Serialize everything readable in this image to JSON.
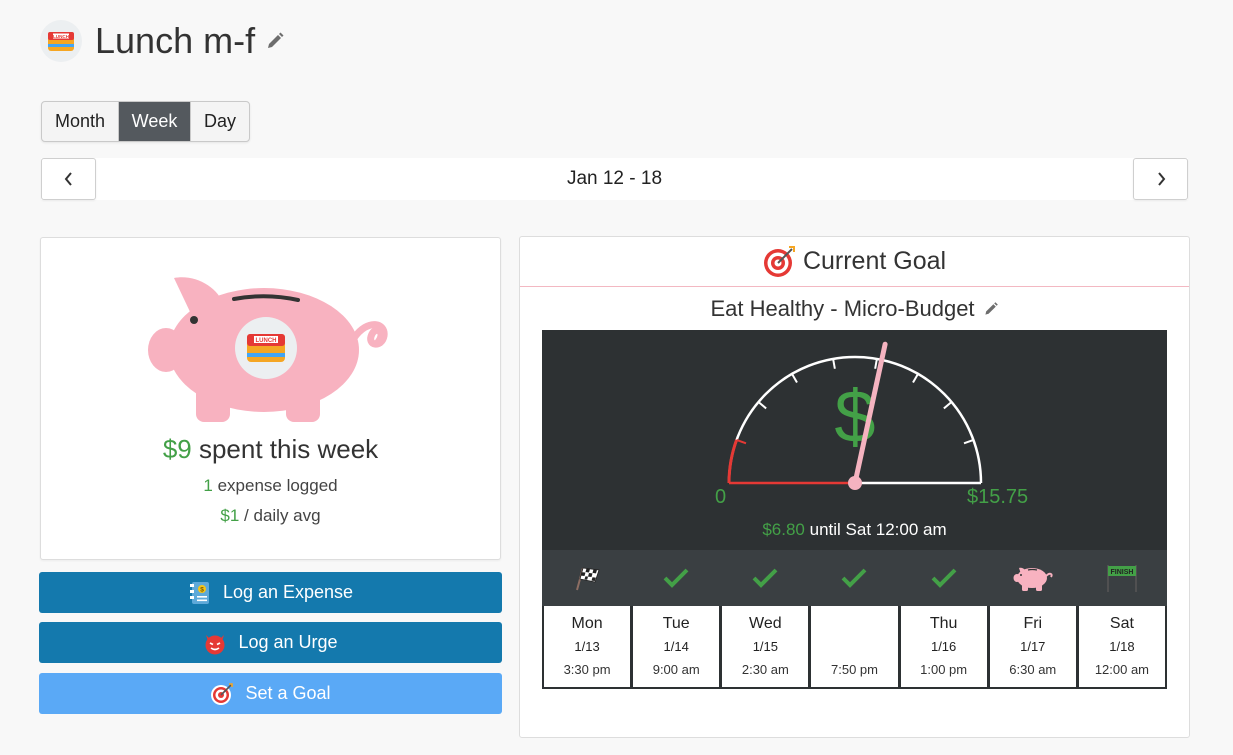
{
  "header": {
    "title": "Lunch m-f",
    "avatar_label": "LUNCH",
    "edit_icon": "pencil-icon"
  },
  "view_toggle": [
    {
      "label": "Month",
      "active": false
    },
    {
      "label": "Week",
      "active": true
    },
    {
      "label": "Day",
      "active": false
    }
  ],
  "date_nav": {
    "range": "Jan 12 - 18",
    "prev_icon": "chevron-left-icon",
    "next_icon": "chevron-right-icon"
  },
  "summary": {
    "spent_amount": "$9",
    "spent_text": "spent this week",
    "expense_count": "1",
    "expense_text": "expense logged",
    "daily_avg_amount": "$1",
    "daily_avg_text": "/ daily avg",
    "piggy_badge_label": "LUNCH"
  },
  "actions": {
    "log_expense": "Log an Expense",
    "log_urge": "Log an Urge",
    "set_goal": "Set a Goal"
  },
  "goal": {
    "heading": "Current Goal",
    "name": "Eat Healthy - Micro-Budget",
    "gauge_min": "0",
    "gauge_max": "$15.75",
    "dollar_sign": "$",
    "remaining_amount": "$6.80",
    "remaining_text": "until Sat 12:00 am",
    "spent_fraction": 0.568
  },
  "days": [
    {
      "icon": "checkered-flag-icon",
      "name": "Mon",
      "date": "1/13",
      "time": "3:30 pm"
    },
    {
      "icon": "checkmark-icon",
      "name": "Tue",
      "date": "1/14",
      "time": "9:00 am"
    },
    {
      "icon": "checkmark-icon",
      "name": "Wed",
      "date": "1/15",
      "time": "2:30 am"
    },
    {
      "icon": "checkmark-icon",
      "name": "",
      "date": "",
      "time": "7:50 pm"
    },
    {
      "icon": "checkmark-icon",
      "name": "Thu",
      "date": "1/16",
      "time": "1:00 pm"
    },
    {
      "icon": "piggy-bank-icon",
      "name": "Fri",
      "date": "1/17",
      "time": "6:30 am"
    },
    {
      "icon": "finish-flag-icon",
      "name": "Sat",
      "date": "1/18",
      "time": "12:00 am",
      "finish_label": "FINISH"
    }
  ],
  "colors": {
    "accent_green": "#43a047",
    "button_blue": "#1479ad",
    "button_light_blue": "#5aa9f6",
    "active_tab": "#54595e",
    "gauge_bg": "#2d3133",
    "needle": "#f5b3c0"
  }
}
